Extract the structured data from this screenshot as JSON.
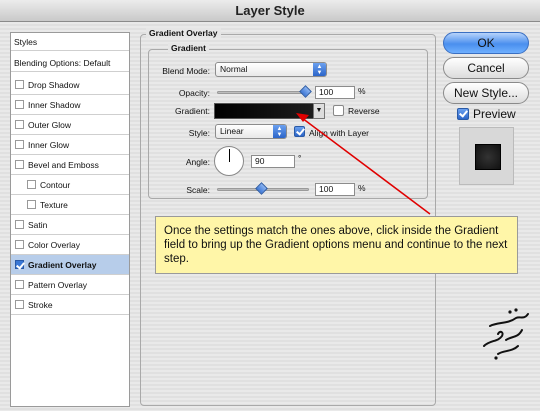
{
  "window": {
    "title": "Layer Style"
  },
  "styles_list": {
    "items": [
      {
        "label": "Styles",
        "checkbox": false,
        "selected": false
      },
      {
        "label": "Blending Options: Default",
        "checkbox": false,
        "selected": false
      },
      {
        "label": "Drop Shadow",
        "checkbox": true,
        "checked": false
      },
      {
        "label": "Inner Shadow",
        "checkbox": true,
        "checked": false
      },
      {
        "label": "Outer Glow",
        "checkbox": true,
        "checked": false
      },
      {
        "label": "Inner Glow",
        "checkbox": true,
        "checked": false
      },
      {
        "label": "Bevel and Emboss",
        "checkbox": true,
        "checked": false
      },
      {
        "label": "Contour",
        "checkbox": true,
        "checked": false
      },
      {
        "label": "Texture",
        "checkbox": true,
        "checked": false
      },
      {
        "label": "Satin",
        "checkbox": true,
        "checked": false
      },
      {
        "label": "Color Overlay",
        "checkbox": true,
        "checked": false
      },
      {
        "label": "Gradient Overlay",
        "checkbox": true,
        "checked": true,
        "selected": true
      },
      {
        "label": "Pattern Overlay",
        "checkbox": true,
        "checked": false
      },
      {
        "label": "Stroke",
        "checkbox": true,
        "checked": false
      }
    ]
  },
  "panel": {
    "outer_legend": "Gradient Overlay",
    "inner_legend": "Gradient",
    "blend_mode": {
      "label": "Blend Mode:",
      "value": "Normal"
    },
    "opacity": {
      "label": "Opacity:",
      "value": "100",
      "unit": "%",
      "level": 1.0
    },
    "gradient": {
      "label": "Gradient:",
      "reverse_label": "Reverse",
      "reverse_checked": false
    },
    "style": {
      "label": "Style:",
      "value": "Linear",
      "align_label": "Align with Layer",
      "align_checked": true
    },
    "angle": {
      "label": "Angle:",
      "value": "90",
      "unit": "°"
    },
    "scale": {
      "label": "Scale:",
      "value": "100",
      "unit": "%",
      "level": 0.5
    }
  },
  "buttons": {
    "ok": "OK",
    "cancel": "Cancel",
    "new_style": "New Style...",
    "preview_label": "Preview",
    "preview_checked": true
  },
  "callout": {
    "text": "Once the settings match the ones above, click inside the Gradient field to bring up the Gradient options menu and continue to the next step."
  },
  "colors": {
    "accent": "#3a78d6",
    "callout_bg": "#fff6a8",
    "arrow": "#e00000",
    "selection": "#b7cdea"
  }
}
